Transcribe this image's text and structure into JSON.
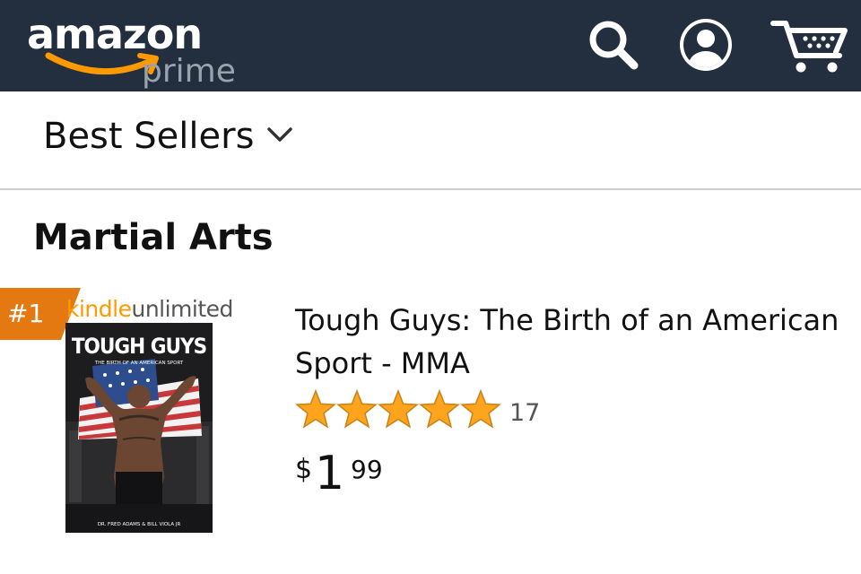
{
  "header": {
    "logo_text": "amazon",
    "logo_subtext": "prime",
    "background_color": "#232f3e",
    "icons": [
      "search-icon",
      "account-icon",
      "cart-icon"
    ]
  },
  "category": {
    "label": "Best Sellers",
    "icon": "chevron-down-icon"
  },
  "section": {
    "title": "Martial Arts"
  },
  "product": {
    "rank": "#1",
    "badge_color": "#e47911",
    "program_logo": {
      "part1": "kindle",
      "part2": "unlimited"
    },
    "cover_text": {
      "title": "TOUGH GUYS",
      "subtitle": "THE BIRTH OF AN AMERICAN SPORT",
      "authors": "DR. FRED ADAMS & BILL VIOLA JR"
    },
    "title": "Tough Guys: The Birth of an American Sport - MMA",
    "rating": 5,
    "rating_max": 5,
    "star_color": "#ffa41c",
    "review_count": "17",
    "price": {
      "symbol": "$",
      "whole": "1",
      "fraction": "99"
    }
  }
}
